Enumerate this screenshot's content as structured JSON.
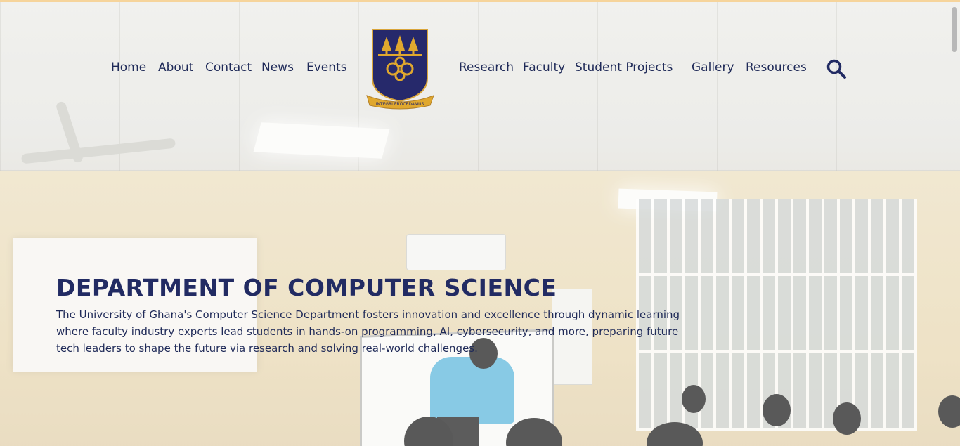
{
  "nav": {
    "left": [
      "Home",
      "About",
      "Contact",
      "News",
      "Events"
    ],
    "right": [
      "Research",
      "Faculty",
      "Student Projects",
      "Gallery",
      "Resources"
    ]
  },
  "logo": {
    "motto": "INTEGRI PROCEDAMUS",
    "icon": "university-crest"
  },
  "search": {
    "icon": "search-icon"
  },
  "hero": {
    "title": "DEPARTMENT OF COMPUTER SCIENCE",
    "description": "The University of Ghana's Computer Science Department fosters innovation and excellence through dynamic learning where faculty industry experts lead students in hands-on programming, AI, cybersecurity, and more, preparing future tech leaders to shape the future via research and solving real-world challenges."
  },
  "colors": {
    "accent": "#222b63",
    "nav_text": "#1f2a58",
    "gold": "#e0a82e",
    "top_strip": "#f6d49b"
  }
}
